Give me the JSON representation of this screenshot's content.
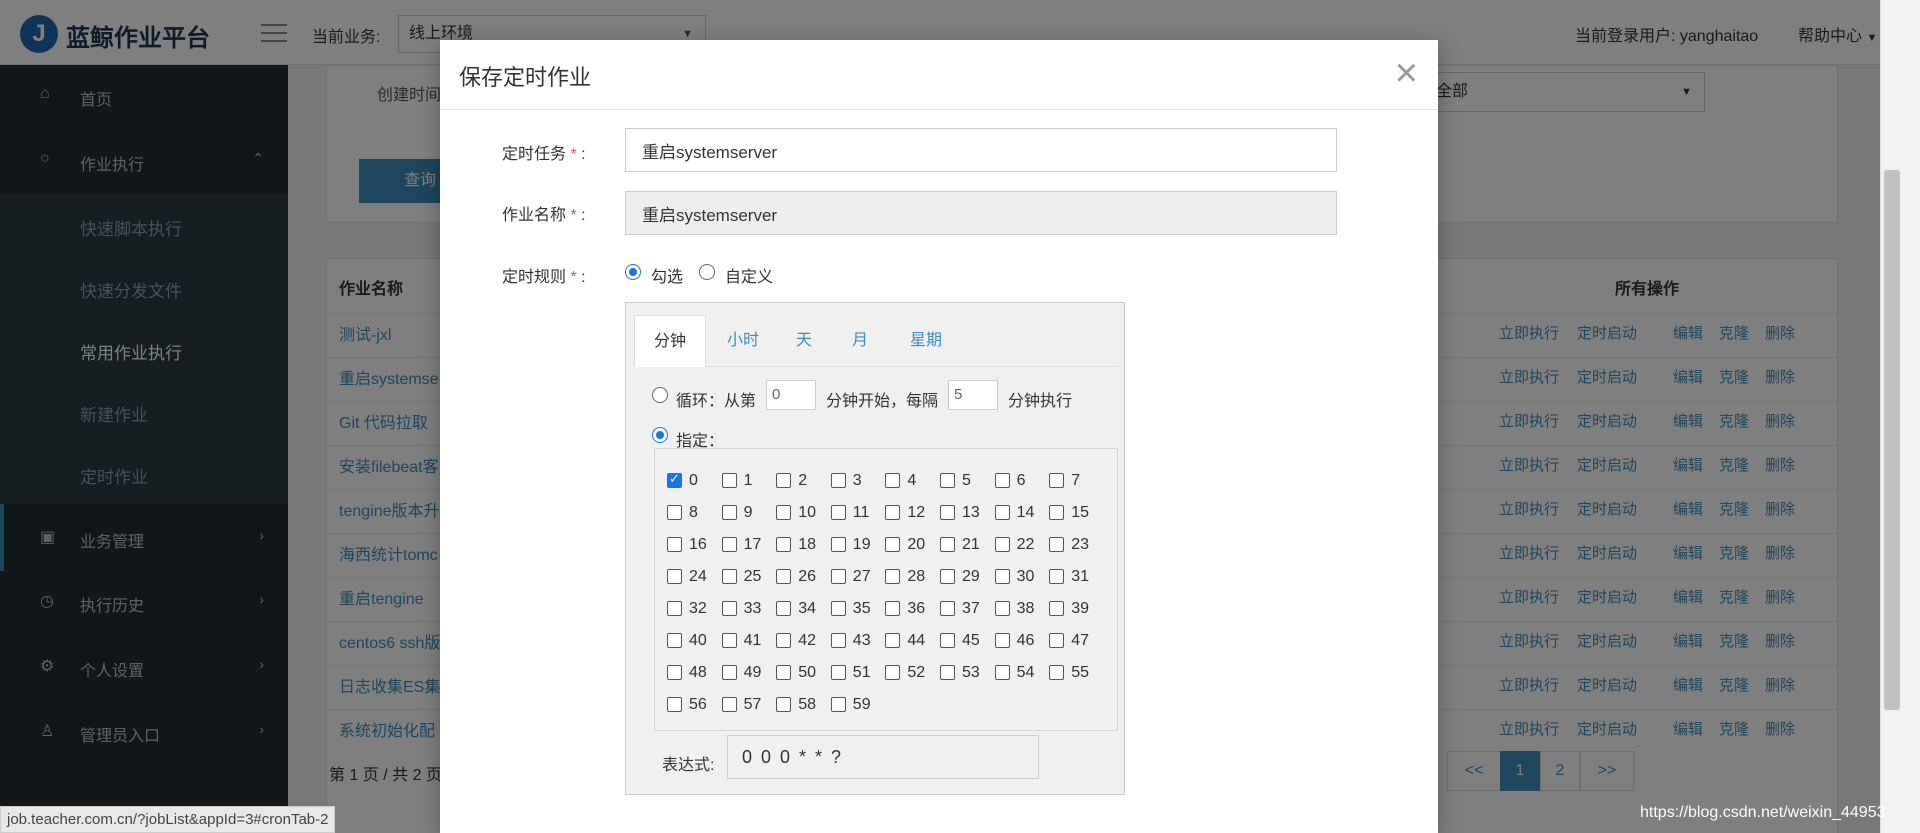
{
  "header": {
    "logo_letter": "J",
    "app_name": "蓝鲸作业平台",
    "business_label": "当前业务:",
    "business_value": "线上环境",
    "current_user": "当前登录用户: yanghaitao",
    "help_center": "帮助中心"
  },
  "sidebar": {
    "items": [
      {
        "label": "首页"
      },
      {
        "label": "作业执行"
      },
      {
        "label": "快速脚本执行"
      },
      {
        "label": "快速分发文件"
      },
      {
        "label": "常用作业执行"
      },
      {
        "label": "新建作业"
      },
      {
        "label": "定时作业"
      },
      {
        "label": "业务管理"
      },
      {
        "label": "执行历史"
      },
      {
        "label": "个人设置"
      },
      {
        "label": "管理员入口"
      }
    ]
  },
  "background": {
    "filter_label": "创建时间",
    "filter_select": "全部",
    "query_button": "查询",
    "col_job_name": "作业名称",
    "col_ops": "所有操作",
    "rows": [
      "测试-jxl",
      "重启systemse",
      "Git 代码拉取",
      "安装filebeat客",
      "tengine版本升",
      "海西统计tomc",
      "重启tengine",
      "centos6 ssh版",
      "日志收集ES集",
      "系统初始化配"
    ],
    "ops": [
      "立即执行",
      "定时启动",
      "编辑",
      "克隆",
      "删除"
    ],
    "pagination_info": "第 1 页 / 共 2 页",
    "pages": [
      "<<",
      "1",
      "2",
      ">>"
    ]
  },
  "modal": {
    "title": "保存定时作业",
    "close": "×",
    "cron_task_label": "定时任务",
    "cron_task_value": "重启systemserver",
    "job_name_label": "作业名称",
    "job_name_value": "重启systemserver",
    "rule_label": "定时规则",
    "required_mark": "*",
    "colon": ":",
    "rule_options": [
      "勾选",
      "自定义"
    ],
    "tabs": [
      "分钟",
      "小时",
      "天",
      "月",
      "星期"
    ],
    "loop_label": "循环：从第",
    "loop_start": "0",
    "loop_mid": "分钟开始，每隔",
    "loop_interval": "5",
    "loop_end": "分钟执行",
    "specify_label": "指定：",
    "checked_minutes": [
      0
    ],
    "expr_label": "表达式:",
    "expr_value": "0 0 0 * * ?"
  },
  "status_bar": "job.teacher.com.cn/?jobList&appId=3#cronTab-2",
  "watermark": "https://blog.csdn.net/weixin_44953"
}
